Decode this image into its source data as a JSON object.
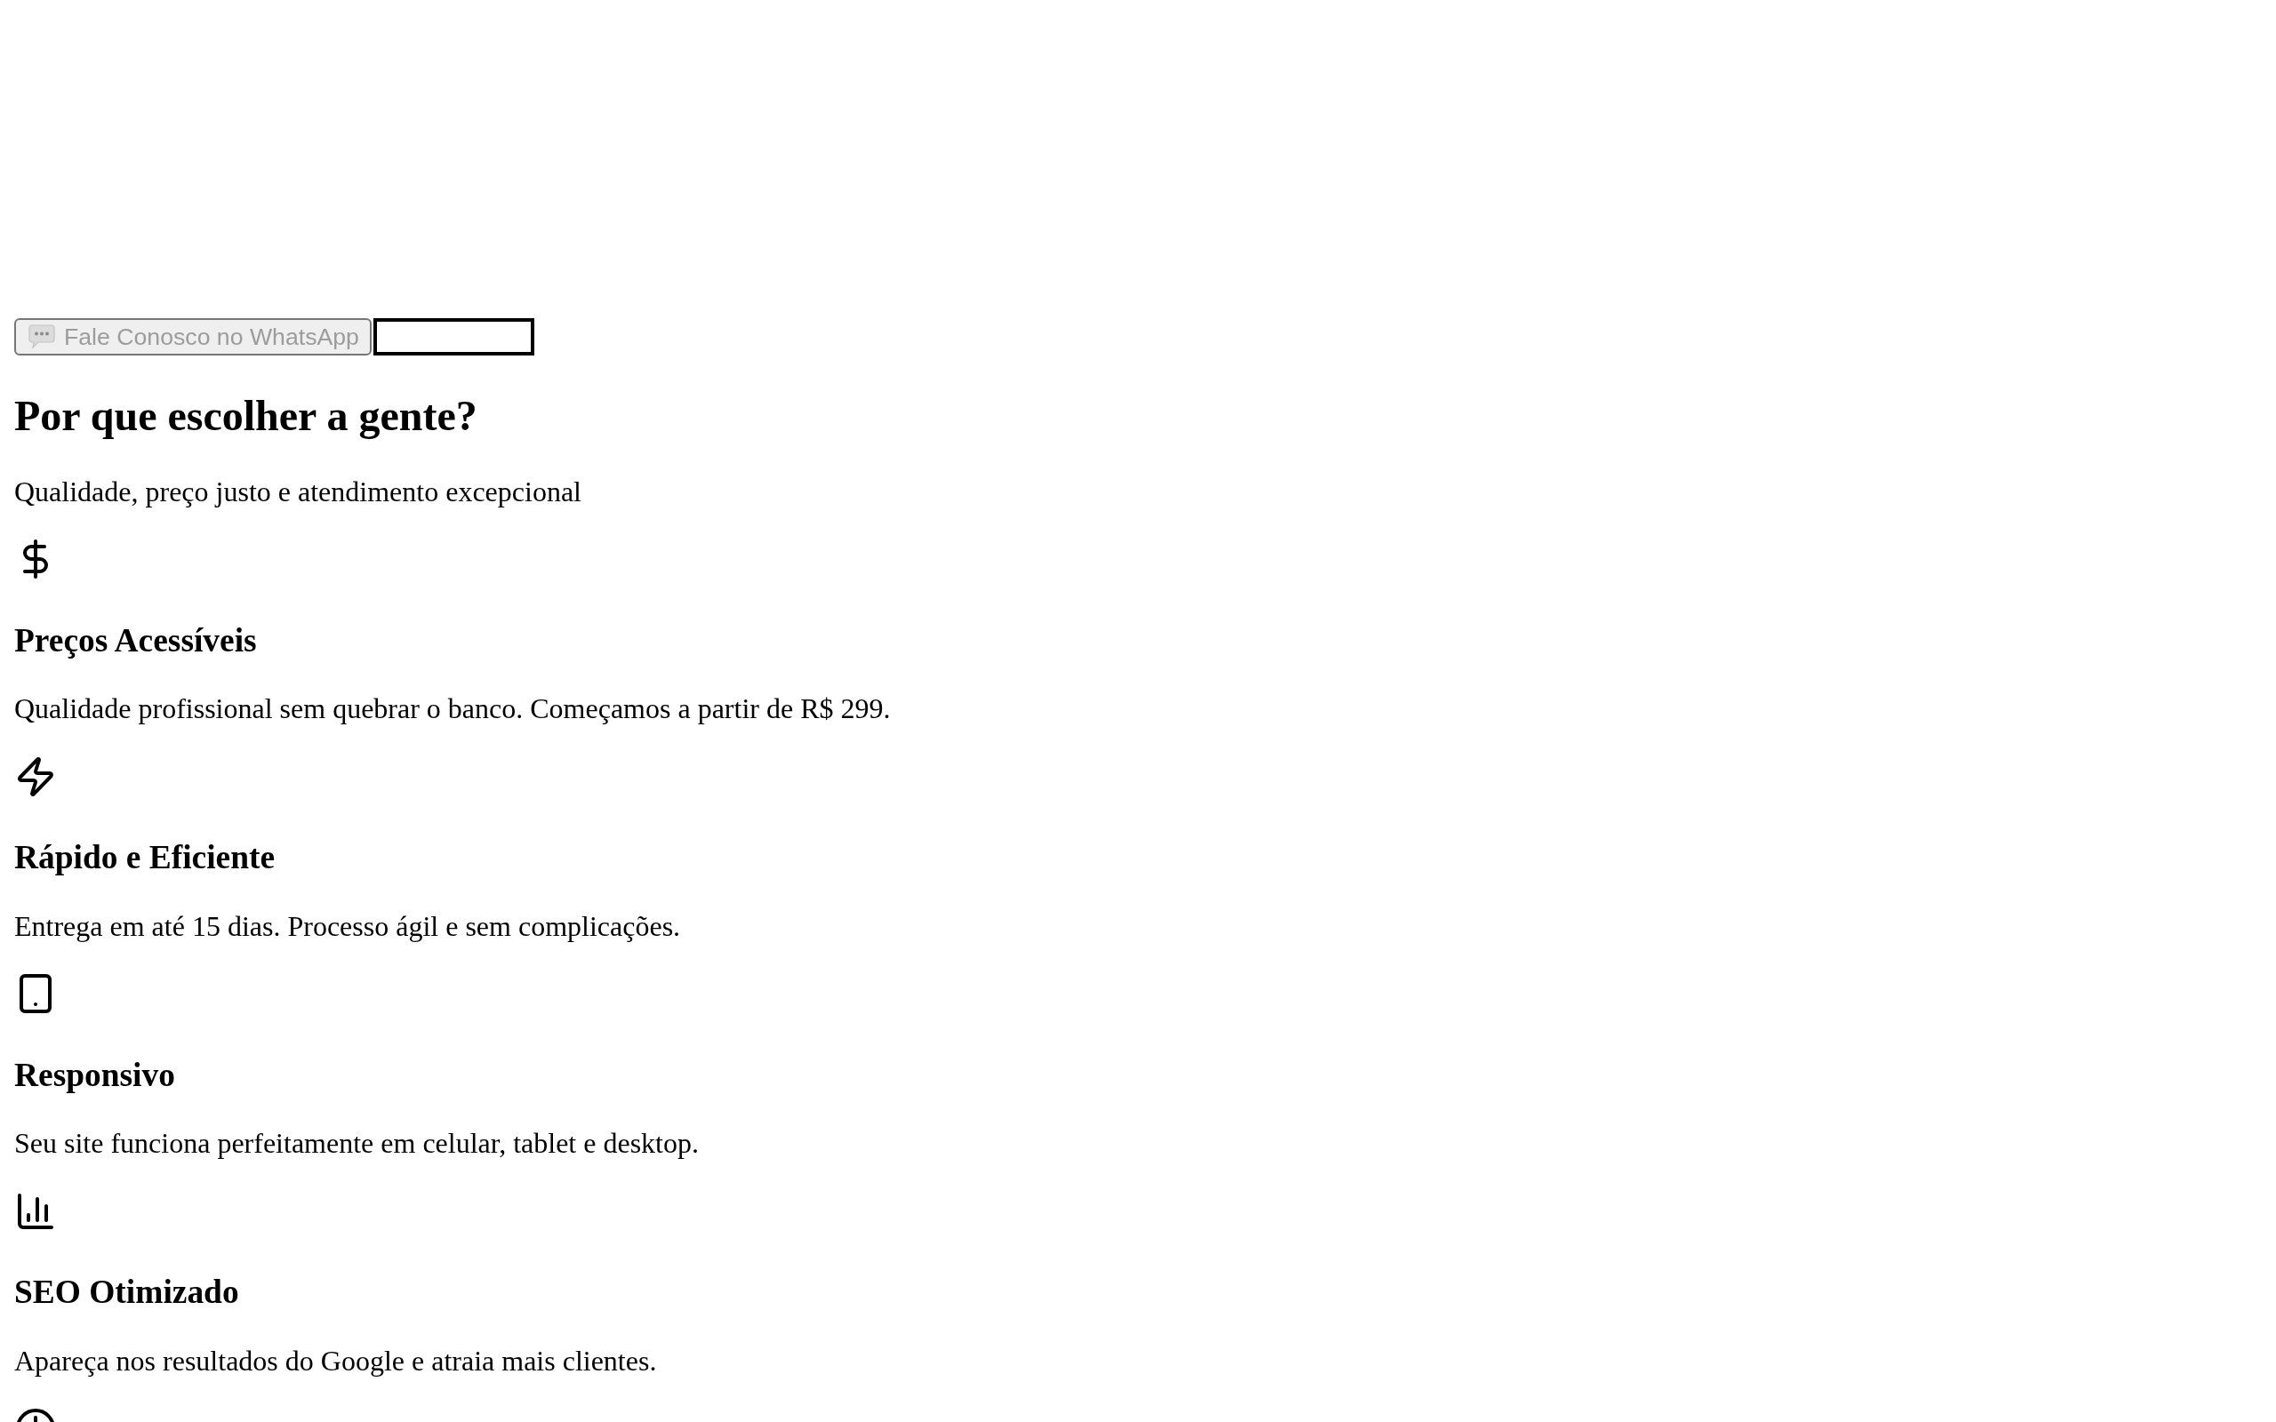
{
  "hero": {
    "buttons": [
      {
        "kind": "primary",
        "label": "Fale Conosco no WhatsApp"
      },
      {
        "kind": "outline"
      }
    ]
  },
  "why_us": {
    "title": "Por que escolher a gente?",
    "subtitle": "Qualidade, preço justo e atendimento excepcional",
    "features": [
      {
        "kind": "full",
        "title": "Preços Acessíveis",
        "description": "Qualidade profissional sem quebrar o banco. Começamos a partir de R$ 299."
      },
      {
        "kind": "full",
        "title": "Rápido e Eficiente",
        "description": "Entrega em até 15 dias. Processo ágil e sem complicações."
      },
      {
        "kind": "full",
        "title": "Responsivo",
        "description": "Seu site funciona perfeitamente em celular, tablet e desktop."
      },
      {
        "kind": "full",
        "title": "SEO Otimizado",
        "description": "Apareça nos resultados do Google e atraia mais clientes."
      },
      {
        "kind": "icon_only"
      }
    ]
  }
}
